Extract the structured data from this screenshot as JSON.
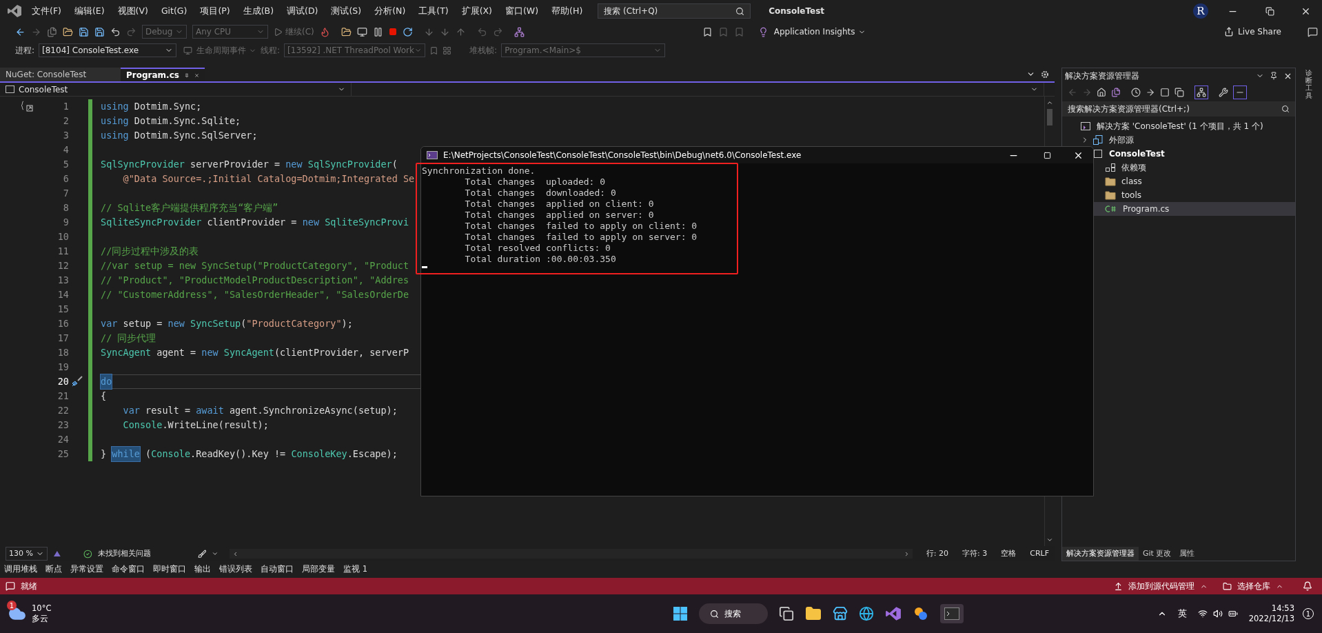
{
  "title_bar": {
    "menus": [
      "文件(F)",
      "编辑(E)",
      "视图(V)",
      "Git(G)",
      "项目(P)",
      "生成(B)",
      "调试(D)",
      "测试(S)",
      "分析(N)",
      "工具(T)",
      "扩展(X)",
      "窗口(W)",
      "帮助(H)"
    ],
    "search": {
      "placeholder": "搜索 (Ctrl+Q)"
    },
    "solution_name": "ConsoleTest",
    "avatar": "R"
  },
  "toolbar": {
    "configuration": "Debug",
    "platform": "Any CPU",
    "continue": "继续(C)",
    "insights": "Application Insights",
    "live_share": "Live Share"
  },
  "debug_location": {
    "process_label": "进程:",
    "process": "[8104] ConsoleTest.exe",
    "lifecycle": "生命周期事件",
    "thread_label": "线程:",
    "thread": "[13592] .NET ThreadPool Work",
    "stack_label": "堆栈帧:",
    "stack_frame": "Program.<Main>$"
  },
  "document_tabs": [
    {
      "label": "NuGet: ConsoleTest",
      "selected": false
    },
    {
      "label": "Program.cs",
      "selected": true
    }
  ],
  "editor": {
    "project": "ConsoleTest",
    "lines": [
      {
        "number": "1",
        "current": false,
        "indent": false,
        "tokens": [
          {
            "kind": "kw",
            "text": "using"
          },
          {
            "kind": "plain",
            "text": " Dotmim.Sync;"
          }
        ]
      },
      {
        "number": "2",
        "current": false,
        "indent": false,
        "tokens": [
          {
            "kind": "kw",
            "text": "using"
          },
          {
            "kind": "plain",
            "text": " Dotmim.Sync.Sqlite;"
          }
        ]
      },
      {
        "number": "3",
        "current": false,
        "indent": false,
        "tokens": [
          {
            "kind": "kw",
            "text": "using"
          },
          {
            "kind": "plain",
            "text": " Dotmim.Sync.SqlServer;"
          }
        ]
      },
      {
        "number": "4",
        "current": false
      },
      {
        "number": "5",
        "current": false,
        "indent": false,
        "tokens": [
          {
            "kind": "type",
            "text": "SqlSyncProvider"
          },
          {
            "kind": "plain",
            "text": " serverProvider = "
          },
          {
            "kind": "kw",
            "text": "new"
          },
          {
            "kind": "type",
            "text": " SqlSyncProvider"
          },
          {
            "kind": "plain",
            "text": "("
          }
        ]
      },
      {
        "number": "6",
        "current": false,
        "indent": true,
        "tokens": [
          {
            "kind": "str",
            "text": "@\"Data Source=.;Initial Catalog=Dotmim;Integrated Se"
          }
        ]
      },
      {
        "number": "7",
        "current": false
      },
      {
        "number": "8",
        "current": false,
        "indent": false,
        "tokens": [
          {
            "kind": "comment",
            "text": "// Sqlite客户端提供程序充当“客户端”"
          }
        ]
      },
      {
        "number": "9",
        "current": false,
        "indent": false,
        "tokens": [
          {
            "kind": "type",
            "text": "SqliteSyncProvider"
          },
          {
            "kind": "plain",
            "text": " clientProvider = "
          },
          {
            "kind": "kw",
            "text": "new"
          },
          {
            "kind": "type",
            "text": " SqliteSyncProvi"
          }
        ]
      },
      {
        "number": "10",
        "current": false
      },
      {
        "number": "11",
        "current": false,
        "indent": false,
        "tokens": [
          {
            "kind": "comment",
            "text": "//同步过程中涉及的表"
          }
        ]
      },
      {
        "number": "12",
        "current": false,
        "indent": false,
        "tokens": [
          {
            "kind": "comment",
            "text": "//var setup = new SyncSetup(\"ProductCategory\", \"Product"
          }
        ]
      },
      {
        "number": "13",
        "current": false,
        "indent": false,
        "tokens": [
          {
            "kind": "comment",
            "text": "// \"Product\", \"ProductModelProductDescription\", \"Addres"
          }
        ]
      },
      {
        "number": "14",
        "current": false,
        "indent": false,
        "tokens": [
          {
            "kind": "comment",
            "text": "// \"CustomerAddress\", \"SalesOrderHeader\", \"SalesOrderDe"
          }
        ]
      },
      {
        "number": "15",
        "current": false
      },
      {
        "number": "16",
        "current": false,
        "indent": false,
        "tokens": [
          {
            "kind": "kw",
            "text": "var"
          },
          {
            "kind": "plain",
            "text": " setup = "
          },
          {
            "kind": "kw",
            "text": "new"
          },
          {
            "kind": "type",
            "text": " SyncSetup"
          },
          {
            "kind": "plain",
            "text": "("
          },
          {
            "kind": "str",
            "text": "\"ProductCategory\""
          },
          {
            "kind": "plain",
            "text": ");"
          }
        ]
      },
      {
        "number": "17",
        "current": false,
        "indent": false,
        "tokens": [
          {
            "kind": "comment",
            "text": "// 同步代理"
          }
        ]
      },
      {
        "number": "18",
        "current": false,
        "indent": false,
        "tokens": [
          {
            "kind": "type",
            "text": "SyncAgent"
          },
          {
            "kind": "plain",
            "text": " agent = "
          },
          {
            "kind": "kw",
            "text": "new"
          },
          {
            "kind": "type",
            "text": " SyncAgent"
          },
          {
            "kind": "plain",
            "text": "(clientProvider, serverP"
          }
        ]
      },
      {
        "number": "19",
        "current": false
      },
      {
        "number": "20",
        "current": true,
        "indent": false,
        "tokens": [
          {
            "kind": "match",
            "text": "do"
          }
        ]
      },
      {
        "number": "21",
        "current": false,
        "indent": false,
        "tokens": [
          {
            "kind": "plain",
            "text": "{"
          }
        ]
      },
      {
        "number": "22",
        "current": false,
        "indent": true,
        "tokens": [
          {
            "kind": "kw",
            "text": "var"
          },
          {
            "kind": "plain",
            "text": " result = "
          },
          {
            "kind": "kw",
            "text": "await"
          },
          {
            "kind": "plain",
            "text": " agent.SynchronizeAsync(setup);"
          }
        ]
      },
      {
        "number": "23",
        "current": false,
        "indent": true,
        "tokens": [
          {
            "kind": "type",
            "text": "Console"
          },
          {
            "kind": "plain",
            "text": ".WriteLine(result);"
          }
        ]
      },
      {
        "number": "24",
        "current": false
      },
      {
        "number": "25",
        "current": false,
        "indent": false,
        "tokens": [
          {
            "kind": "plain",
            "text": "} "
          },
          {
            "kind": "match",
            "text": "while"
          },
          {
            "kind": "plain",
            "text": " ("
          },
          {
            "kind": "type",
            "text": "Console"
          },
          {
            "kind": "plain",
            "text": ".ReadKey().Key != "
          },
          {
            "kind": "type",
            "text": "ConsoleKey"
          },
          {
            "kind": "plain",
            "text": ".Escape);"
          }
        ]
      }
    ],
    "zoom": "130 %",
    "issues": "未找到相关问题",
    "line": "行: 20",
    "column": "字符: 3",
    "indent_mode": "空格",
    "line_ending": "CRLF"
  },
  "console": {
    "title": "E:\\NetProjects\\ConsoleTest\\ConsoleTest\\ConsoleTest\\bin\\Debug\\net6.0\\ConsoleTest.exe",
    "output": [
      {
        "kind": "header",
        "text": "Synchronization done."
      },
      {
        "kind": "detail",
        "text": "Total changes  uploaded: 0"
      },
      {
        "kind": "detail",
        "text": "Total changes  downloaded: 0"
      },
      {
        "kind": "detail",
        "text": "Total changes  applied on client: 0"
      },
      {
        "kind": "detail",
        "text": "Total changes  applied on server: 0"
      },
      {
        "kind": "detail",
        "text": "Total changes  failed to apply on client: 0"
      },
      {
        "kind": "detail",
        "text": "Total changes  failed to apply on server: 0"
      },
      {
        "kind": "detail",
        "text": "Total resolved conflicts: 0"
      },
      {
        "kind": "detail",
        "text": "Total duration :00.00:03.350"
      }
    ]
  },
  "solution_explorer": {
    "title": "解决方案资源管理器",
    "search": {
      "placeholder": "搜索解决方案资源管理器(Ctrl+;)"
    },
    "tree": [
      {
        "label": "解决方案 'ConsoleTest' (1 个项目，共 1 个)",
        "kind": "solution",
        "selected": false,
        "children": [
          {
            "label": "外部源",
            "kind": "external",
            "selected": false,
            "expanded": false
          },
          {
            "label": "ConsoleTest",
            "kind": "project",
            "selected": false,
            "children": [
              {
                "label": "依赖项",
                "kind": "dependencies",
                "selected": false
              },
              {
                "label": "class",
                "kind": "folder",
                "selected": false
              },
              {
                "label": "tools",
                "kind": "folder",
                "selected": false
              },
              {
                "label": "Program.cs",
                "kind": "csharp",
                "selected": true
              }
            ]
          }
        ]
      }
    ]
  },
  "side_panel_tabs": [
    {
      "label": "解决方案资源管理器",
      "selected": true
    },
    {
      "label": "Git 更改",
      "selected": false
    },
    {
      "label": "属性",
      "selected": false
    }
  ],
  "right_edge_tab": "诊断工具",
  "tool_tabs": [
    "调用堆栈",
    "断点",
    "异常设置",
    "命令窗口",
    "即时窗口",
    "输出",
    "错误列表",
    "自动窗口",
    "局部变量",
    "监视 1"
  ],
  "status_bar": {
    "message": "就绪",
    "source_control": "添加到源代码管理",
    "repository": "选择仓库"
  },
  "taskbar": {
    "temperature": "10°C",
    "weather": "多云",
    "weather_badge": "1",
    "search": "搜索",
    "language": "英",
    "time": "14:53",
    "date": "2022/12/13",
    "notification_count": "1"
  }
}
